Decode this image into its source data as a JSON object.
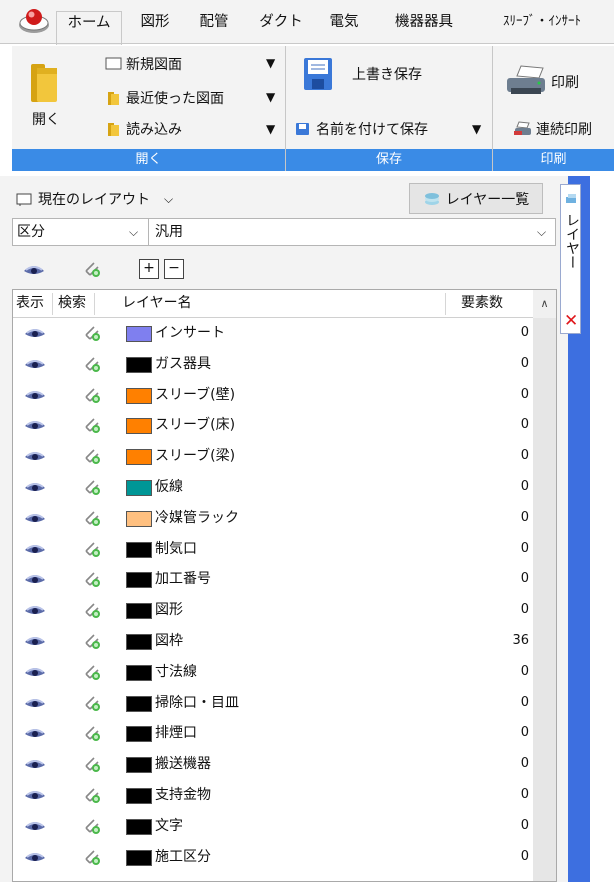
{
  "tabs": [
    {
      "label": "ホーム",
      "active": true
    },
    {
      "label": "図形"
    },
    {
      "label": "配管"
    },
    {
      "label": "ダクト"
    },
    {
      "label": "電気"
    },
    {
      "label": "機器器具"
    },
    {
      "label": "ｽﾘｰﾌﾞ・ｲﾝｻｰﾄ"
    }
  ],
  "ribbon": {
    "open_group": {
      "big_button_label": "開く",
      "new_drawing": "新規図面",
      "recent_drawing": "最近使った図面",
      "import": "読み込み",
      "label": "開く"
    },
    "save_group": {
      "overwrite_save": "上書き保存",
      "save_as": "名前を付けて保存",
      "label": "保存"
    },
    "print_group": {
      "print": "印刷",
      "batch_print": "連続印刷",
      "label": "印刷"
    },
    "accent_color": "#3a8be6"
  },
  "panel": {
    "layout_combo": "現在のレイアウト",
    "layer_list_button": "レイヤー一覧",
    "category_combo": "区分",
    "type_combo": "汎用",
    "columns": {
      "show": "表示",
      "search": "検索",
      "layer_name": "レイヤー名",
      "count": "要素数"
    },
    "layers": [
      {
        "name": "インサート",
        "color": "#7f7fef",
        "count": "0"
      },
      {
        "name": "ガス器具",
        "color": "#000000",
        "count": "0"
      },
      {
        "name": "スリーブ(壁)",
        "color": "#ff8000",
        "count": "0"
      },
      {
        "name": "スリーブ(床)",
        "color": "#ff8000",
        "count": "0"
      },
      {
        "name": "スリーブ(梁)",
        "color": "#ff8000",
        "count": "0"
      },
      {
        "name": "仮線",
        "color": "#009696",
        "count": "0"
      },
      {
        "name": "冷媒管ラック",
        "color": "#ffc080",
        "count": "0"
      },
      {
        "name": "制気口",
        "color": "#000000",
        "count": "0"
      },
      {
        "name": "加工番号",
        "color": "#000000",
        "count": "0"
      },
      {
        "name": "図形",
        "color": "#000000",
        "count": "0"
      },
      {
        "name": "図枠",
        "color": "#000000",
        "count": "36"
      },
      {
        "name": "寸法線",
        "color": "#000000",
        "count": "0"
      },
      {
        "name": "掃除口・目皿",
        "color": "#000000",
        "count": "0"
      },
      {
        "name": "排煙口",
        "color": "#000000",
        "count": "0"
      },
      {
        "name": "搬送機器",
        "color": "#000000",
        "count": "0"
      },
      {
        "name": "支持金物",
        "color": "#000000",
        "count": "0"
      },
      {
        "name": "文字",
        "color": "#000000",
        "count": "0"
      },
      {
        "name": "施工区分",
        "color": "#000000",
        "count": "0"
      }
    ]
  },
  "side_panel": {
    "tab_label": "レイヤー",
    "close_icon": "close-icon",
    "bar_color": "#3d6fe0"
  }
}
